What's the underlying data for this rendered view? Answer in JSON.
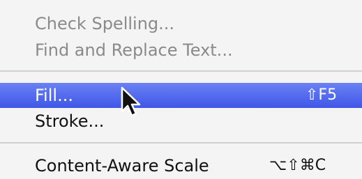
{
  "menu": {
    "items": [
      {
        "label": "Check Spelling...",
        "state": "disabled"
      },
      {
        "label": "Find and Replace Text...",
        "state": "disabled"
      },
      {
        "label": "Fill...",
        "state": "highlighted",
        "shortcut": "⇧F5"
      },
      {
        "label": "Stroke...",
        "state": "enabled"
      },
      {
        "label": "Content-Aware Scale",
        "state": "enabled",
        "shortcut": "⌥⇧⌘C"
      }
    ]
  },
  "colors": {
    "highlight": "#4a62ee",
    "disabled_text": "#8a8a8a",
    "background": "#f4f4f4"
  },
  "cursor": {
    "icon": "arrow-pointer-icon"
  }
}
